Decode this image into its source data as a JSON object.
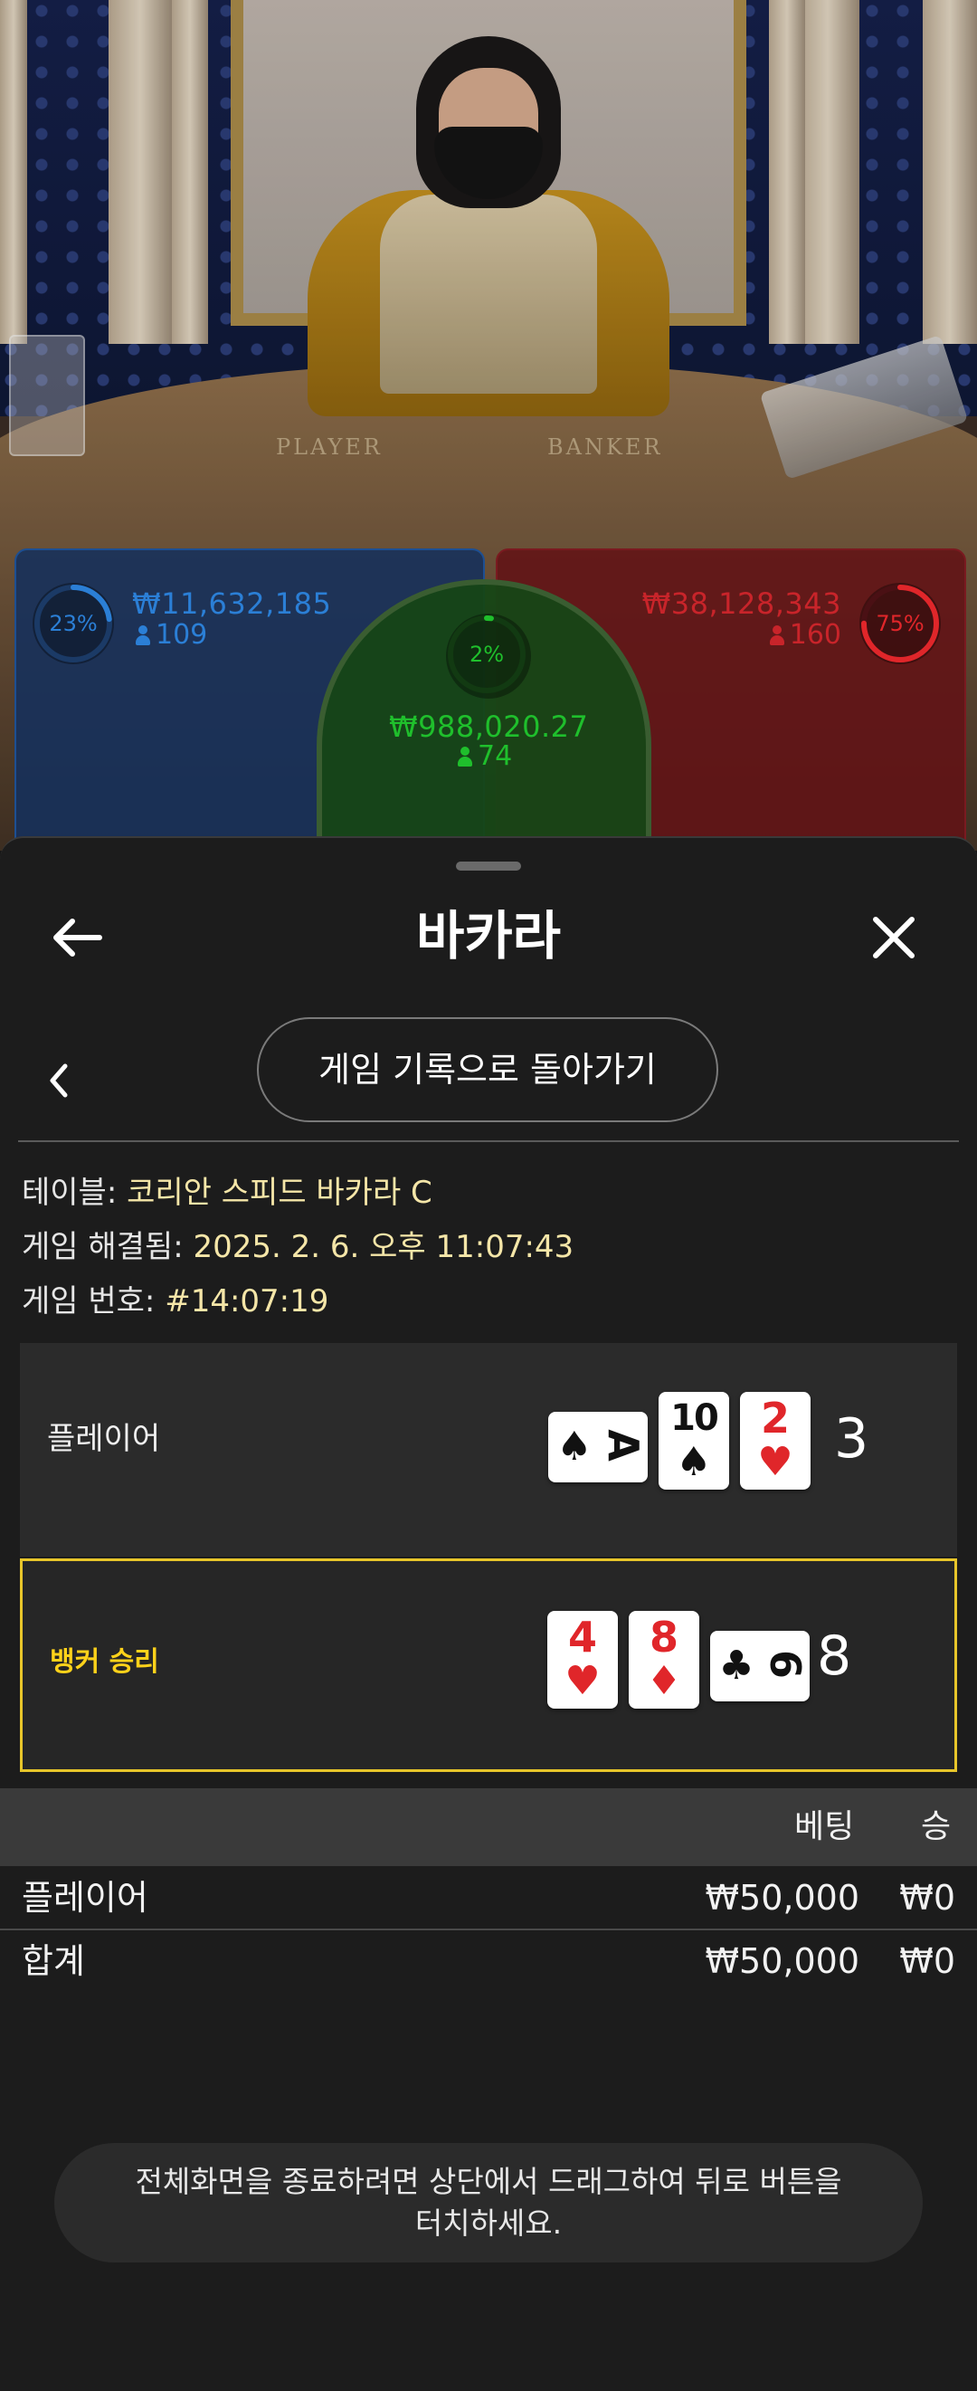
{
  "video": {
    "felt_player_label": "PLAYER",
    "felt_banker_label": "BANKER",
    "player_zone": {
      "percent": "23%",
      "percent_value": 0.23,
      "amount": "₩11,632,185",
      "players": "109",
      "color": "#2b7fd6"
    },
    "tie_zone": {
      "percent": "2%",
      "percent_value": 0.02,
      "amount": "₩988,020.27",
      "players": "74",
      "color": "#1fbf2c"
    },
    "banker_zone": {
      "percent": "75%",
      "percent_value": 0.75,
      "amount": "₩38,128,343",
      "players": "160",
      "color": "#e0262a"
    }
  },
  "sheet": {
    "header": {
      "title": "바카라",
      "back_icon": "arrow-left-icon",
      "close_icon": "close-x-icon"
    },
    "sub_nav": {
      "back_icon": "chevron-left-icon",
      "button_label": "게임 기록으로 돌아가기"
    },
    "info": {
      "table_label": "테이블:",
      "table_value": "코리안 스피드 바카라 C",
      "resolved_label": "게임 해결됨:",
      "resolved_value": "2025. 2. 6. 오후 11:07:43",
      "number_label": "게임 번호:",
      "number_value": "#14:07:19"
    },
    "hands": [
      {
        "label": "플레이어",
        "winner": false,
        "score": "3",
        "cards": [
          {
            "rank": "A",
            "suit": "♠",
            "red": false,
            "sideways": true
          },
          {
            "rank": "10",
            "suit": "♠",
            "red": false,
            "sideways": false
          },
          {
            "rank": "2",
            "suit": "♥",
            "red": true,
            "sideways": false
          }
        ]
      },
      {
        "label": "뱅커 승리",
        "winner": true,
        "score": "8",
        "cards": [
          {
            "rank": "4",
            "suit": "♥",
            "red": true,
            "sideways": false
          },
          {
            "rank": "8",
            "suit": "♦",
            "red": true,
            "sideways": false
          },
          {
            "rank": "6",
            "suit": "♣",
            "red": false,
            "sideways": true
          }
        ]
      }
    ],
    "bets": {
      "columns": {
        "bet": "베팅",
        "win": "승"
      },
      "rows": [
        {
          "label": "플레이어",
          "bet": "₩50,000",
          "win": "₩0"
        }
      ],
      "total": {
        "label": "합계",
        "bet": "₩50,000",
        "win": "₩0"
      }
    },
    "toast": "전체화면을 종료하려면 상단에서 드래그하여 뒤로 버튼을\n터치하세요.",
    "accent_color": "#e7c52a"
  }
}
